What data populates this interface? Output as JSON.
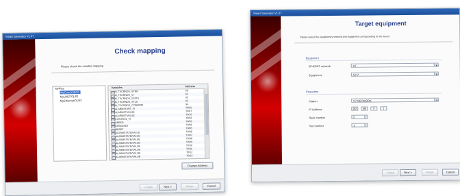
{
  "window_left": {
    "title": "Smart Generator V1.07",
    "heading": "Check mapping",
    "instruction": "Please check the variable mapping",
    "tree": {
      "root": "MyPlus",
      "items": [
        "MyComUSB/01",
        "MyLNET/01/02",
        "MyEthernet/01/03"
      ],
      "selected_index": 0
    },
    "table": {
      "columns": [
        "Variables",
        "Address"
      ],
      "rows": [
        {
          "var": "M_TSCRNDS_SYNN",
          "addr": "S0"
        },
        {
          "var": "M_TSCRNDS_VI",
          "addr": "S1"
        },
        {
          "var": "M_TSCRNDS_STATE",
          "addr": "S2"
        },
        {
          "var": "M_TSCRNDS_STLS",
          "addr": "S3"
        },
        {
          "var": "M_TSCRNDS_CONFIRM",
          "addr": "S4"
        },
        {
          "var": "ALARMSTART_VI",
          "addr": "T0/02"
        },
        {
          "var": "ALARMSTVALUE",
          "addr": "T0/07"
        },
        {
          "var": "ALARMSTVALUE",
          "addr": "T0/10"
        },
        {
          "var": "CONTROL_VI",
          "addr": "T0/03"
        },
        {
          "var": "SPEED",
          "addr": "T0/03"
        },
        {
          "var": "SPEEDSET",
          "addr": "T0/04"
        },
        {
          "var": "RESET",
          "addr": "T0/05"
        },
        {
          "var": "ALARMSTATE/VALUE",
          "addr": "T0/06"
        },
        {
          "var": "ALARMSTATE/VALUE",
          "addr": "T0/07"
        },
        {
          "var": "ALARMSTATE/VALUE",
          "addr": "T0/08"
        },
        {
          "var": "ALARMSTATE/VALUE",
          "addr": "T0/09"
        },
        {
          "var": "ALARMSTATE/VALUE",
          "addr": "T0/10"
        },
        {
          "var": "ALARMSTATE/VALUE",
          "addr": "T0/11"
        },
        {
          "var": "ALARMSTATE/VALUE",
          "addr": "T0/12"
        },
        {
          "var": "ALARMSTATE/VALUE",
          "addr": "T0/13"
        }
      ]
    },
    "change_button": "Change Address",
    "buttons": {
      "back": "< Back",
      "next": "Next >",
      "finish": "Finish",
      "cancel": "Cancel"
    }
  },
  "window_right": {
    "title": "Smart Generator V1.07",
    "heading": "Target equipment",
    "instruction": "Please select the equipment's network and equipment corresponding to the layout",
    "group1": {
      "label": "Equipment",
      "fields": [
        {
          "label": "SP400ST network",
          "value": "S7"
        },
        {
          "label": "Equipment",
          "value": "S7/7"
        }
      ]
    },
    "group2": {
      "label": "Properties",
      "fields": [
        {
          "label": "Station",
          "value": "S7 NETWORK"
        },
        {
          "label": "IP Address",
          "value": ""
        },
        {
          "label": "Rack number",
          "value": "0"
        },
        {
          "label": "Slot number",
          "value": "2"
        }
      ],
      "ip_parts": [
        "192",
        "168",
        "0",
        "1"
      ]
    },
    "buttons": {
      "back": "< Back",
      "next": "Next >",
      "finish": "Finish",
      "cancel": "Cancel"
    }
  }
}
